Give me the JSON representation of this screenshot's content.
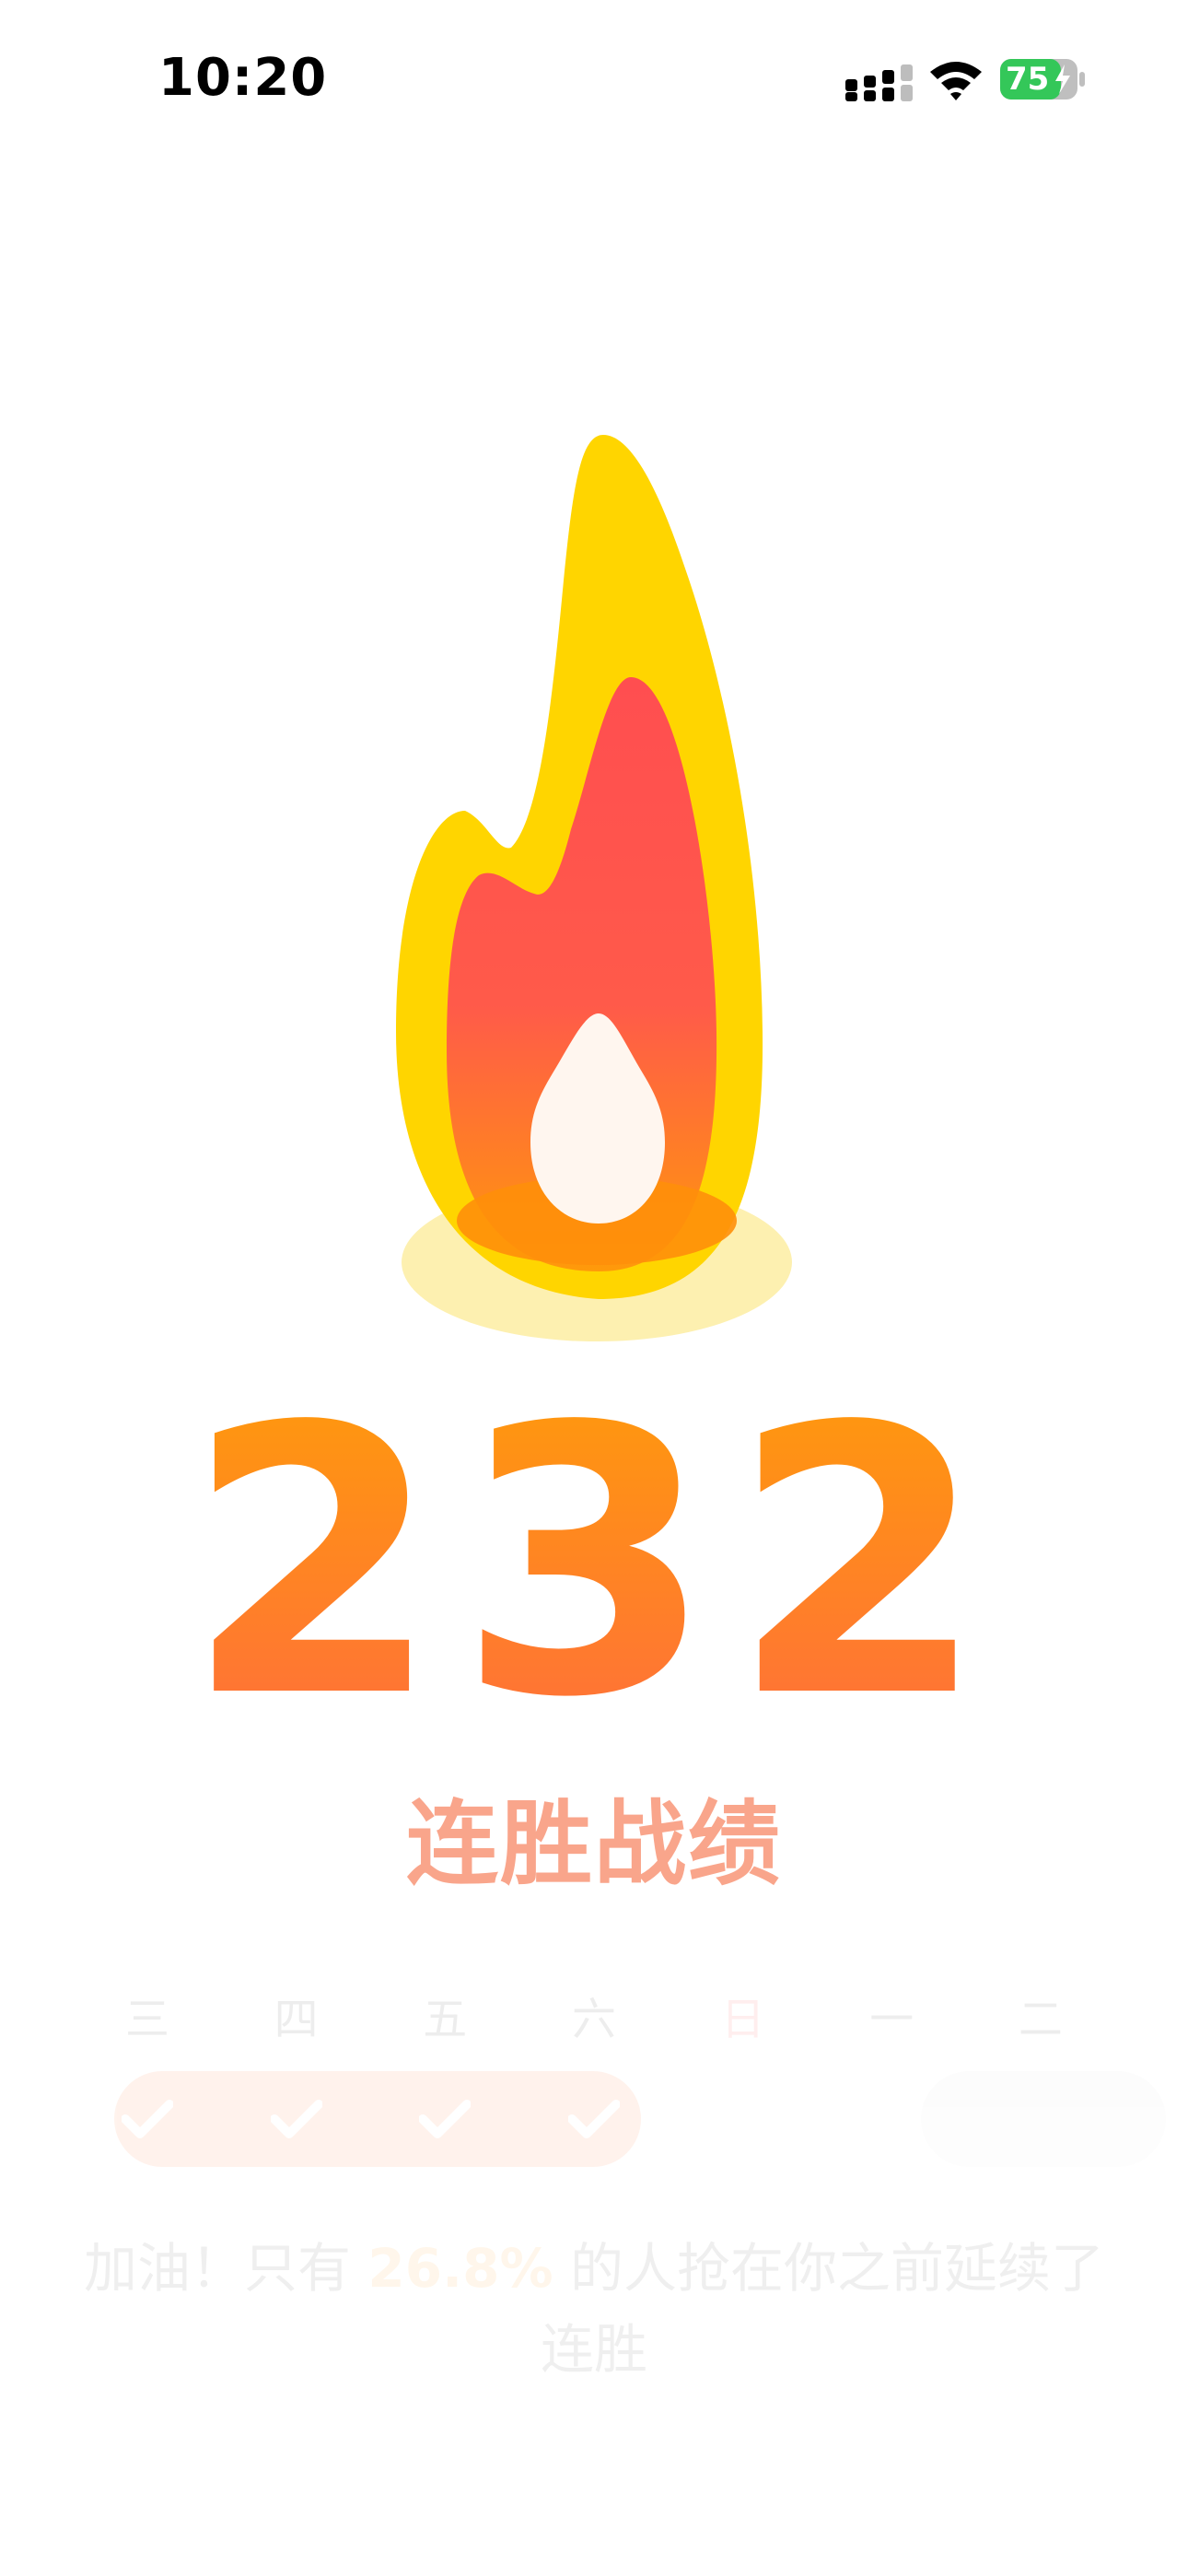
{
  "status_bar": {
    "time": "10:20",
    "battery_level": "75",
    "icons": [
      "signal-icon",
      "wifi-icon",
      "battery-icon"
    ]
  },
  "streak": {
    "count": "232",
    "label": "连胜战绩"
  },
  "week": {
    "days": [
      {
        "label": "三",
        "done": true
      },
      {
        "label": "四",
        "done": true
      },
      {
        "label": "五",
        "done": true
      },
      {
        "label": "六",
        "done": true
      },
      {
        "label": "日",
        "done": false,
        "today": true
      },
      {
        "label": "一",
        "done": false
      },
      {
        "label": "二",
        "done": false
      }
    ]
  },
  "encourage": {
    "prefix": "加油！只有 ",
    "percent": "26.8%",
    "suffix": " 的人抢在你之前延续了连胜"
  },
  "colors": {
    "flame_outer": "#FFD400",
    "flame_inner": "#FF4E50",
    "flame_base": "#FF8F0A",
    "number_top": "#FF9A0C",
    "number_bottom": "#FF6F3A",
    "label": "#F9A58B"
  }
}
